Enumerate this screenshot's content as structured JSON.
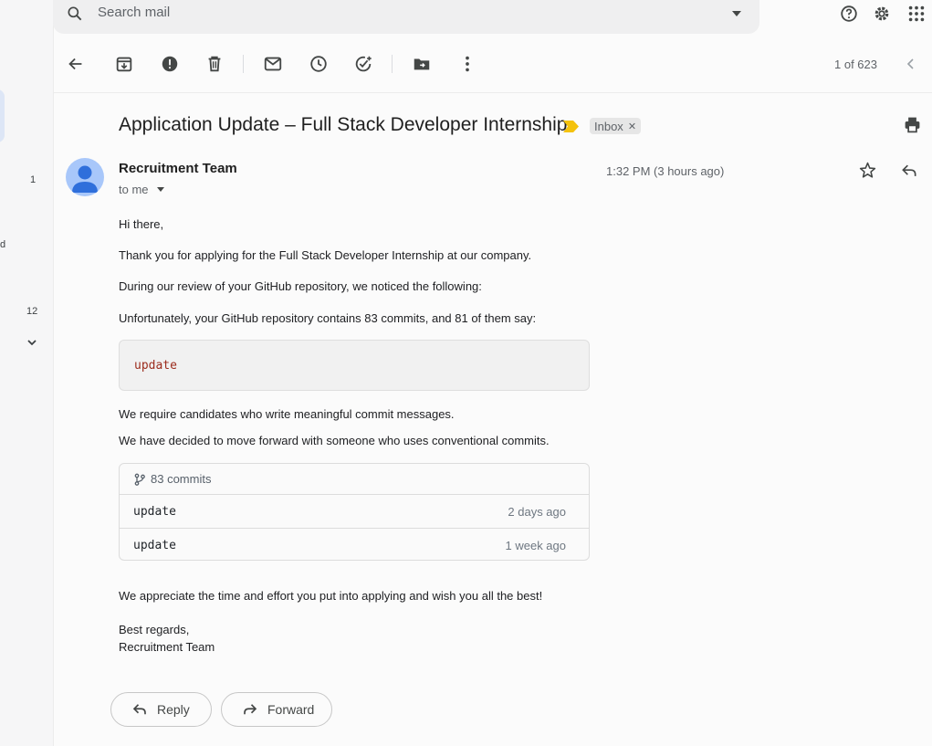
{
  "search": {
    "placeholder": "Search mail"
  },
  "left_rail": {
    "counts": [
      "1",
      "12"
    ],
    "partial_letter": "d"
  },
  "toolbar": {
    "pager": "1 of 623"
  },
  "email": {
    "subject": "Application Update – Full Stack Developer Internship",
    "label": "Inbox",
    "sender": "Recruitment Team",
    "recipient": "to me",
    "time": "1:32 PM (3 hours ago)",
    "body": {
      "greeting": "Hi there,",
      "p1": "Thank you for applying for the Full Stack Developer Internship at our company.",
      "p2": "During our review of your GitHub repository, we noticed the following:",
      "p3": "Unfortunately, your GitHub repository contains 83 commits, and 81 of them say:",
      "code": "update",
      "p4": "We require candidates who write meaningful commit messages.",
      "p5": "We have decided to move forward with someone who uses conventional commits.",
      "commits": {
        "count_label": "83 commits",
        "rows": [
          {
            "message": "update",
            "age": "2 days ago"
          },
          {
            "message": "update",
            "age": "1 week ago"
          }
        ]
      },
      "p6": "We appreciate the time and effort you put into applying and wish you all the best!",
      "signoff": "Best regards,",
      "signature": "Recruitment Team"
    }
  },
  "actions": {
    "reply": "Reply",
    "forward": "Forward"
  },
  "colors": {
    "avatar": "#a8c7fa",
    "avatar_figure": "#2f6fdb",
    "importance": "#f4c20d",
    "code_text": "#9c2c1d"
  }
}
